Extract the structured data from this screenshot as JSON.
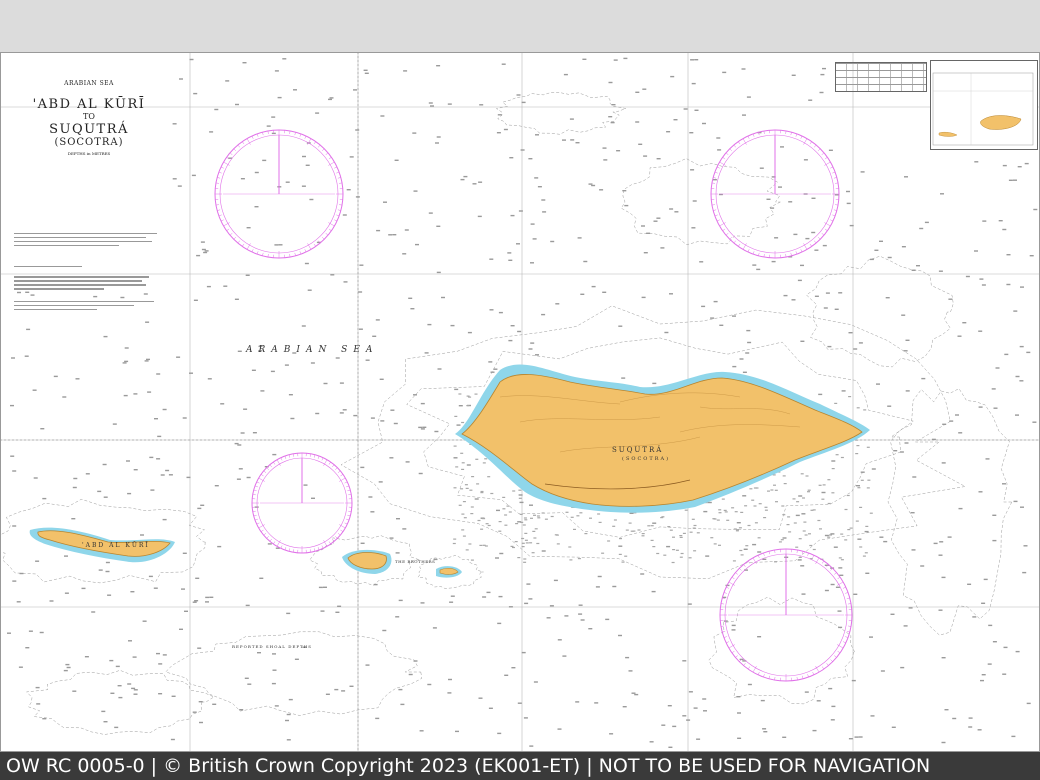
{
  "chart_title": {
    "sea_heading": "ARABIAN SEA",
    "line1": "'ABD AL KŪRĪ",
    "connector": "TO",
    "line2": "SUQUTRÁ",
    "alt_name": "(SOCOTRA)",
    "depths_note": "DEPTHS in METRES"
  },
  "labels": {
    "sea_name": "ARABIAN SEA",
    "main_island": "SUQUTRÁ",
    "main_island_alt": "(SOCOTRA)",
    "west_island": "'ABD AL KŪRĪ",
    "brothers": "THE BROTHERS",
    "shoal": "REPORTED SHOAL DEPTHS"
  },
  "colors": {
    "land": "#f2c16a",
    "land_edge": "#b8852e",
    "shallow_water": "#8fd6ea",
    "compass_rose": "#e070e8",
    "grid": "#b8b8b8",
    "contour": "#9a9a9a",
    "footer_bg": "#3a3a3a",
    "footer_text": "#ffffff"
  },
  "footer": {
    "text": "OW RC 0005-0 | © British Crown Copyright 2023 (EK001-ET) | NOT TO BE USED FOR NAVIGATION"
  }
}
